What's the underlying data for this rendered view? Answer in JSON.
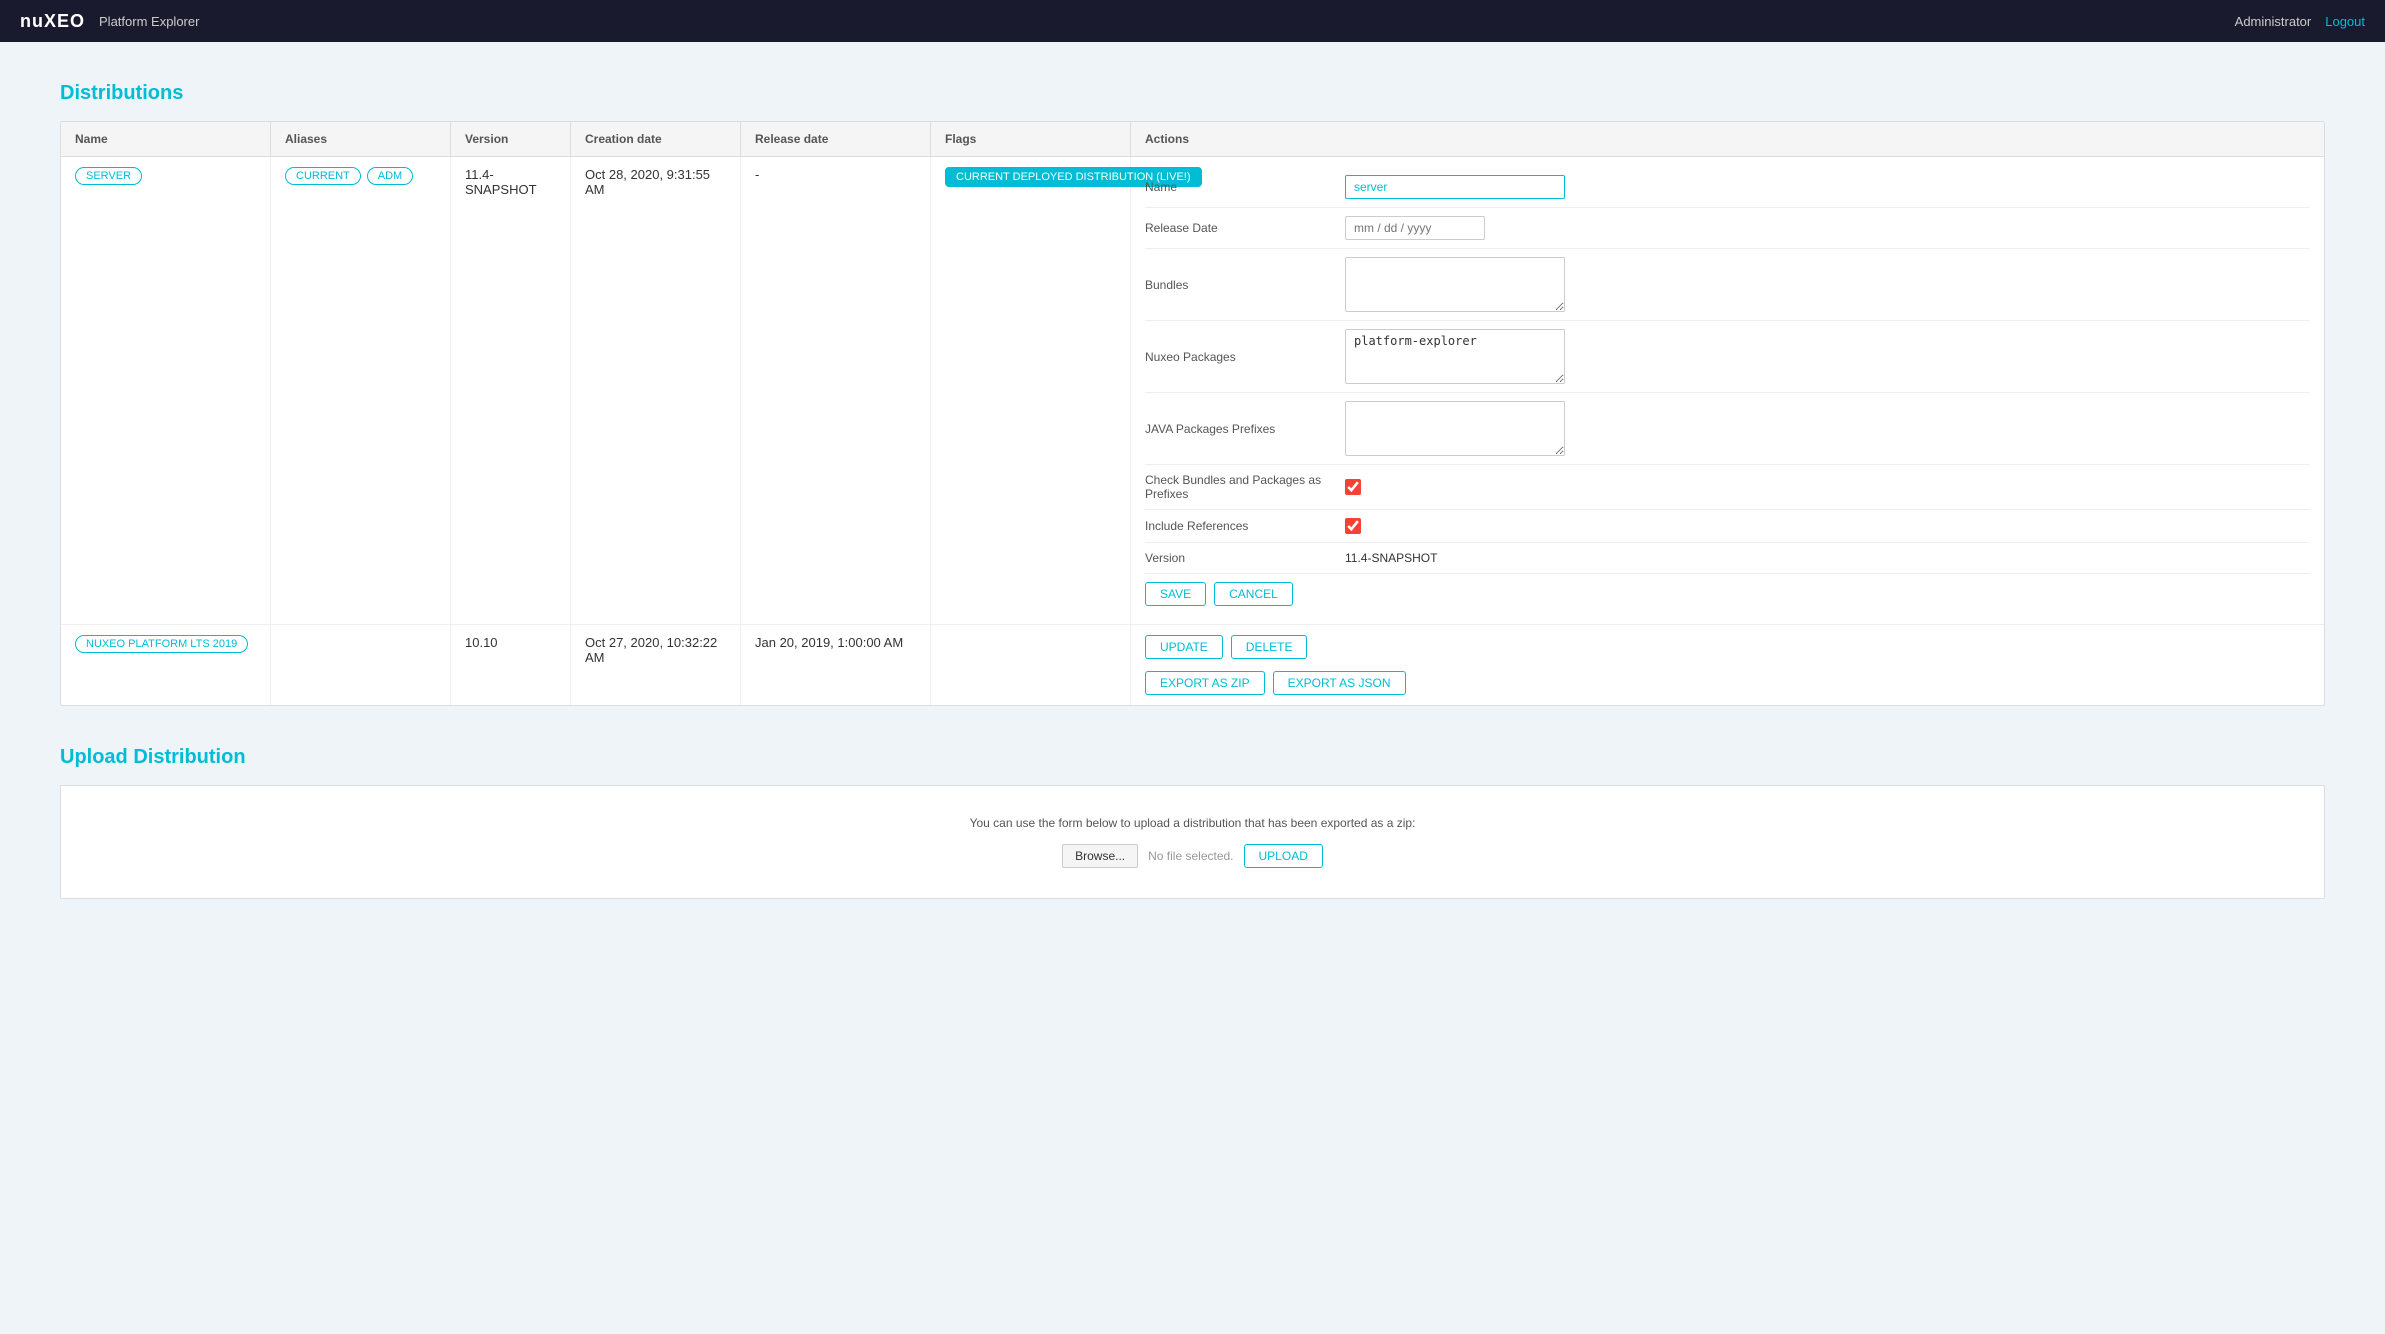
{
  "header": {
    "logo_nu": "nu",
    "logo_xeo": "XEO",
    "platform_explorer": "Platform Explorer",
    "user": "Administrator",
    "logout": "Logout"
  },
  "distributions": {
    "title": "Distributions",
    "table_headers": [
      "Name",
      "Aliases",
      "Version",
      "Creation date",
      "Release date",
      "Flags",
      "Actions"
    ],
    "row1": {
      "name_badge": "SERVER",
      "aliases": [
        "CURRENT",
        "ADM"
      ],
      "version": "11.4-SNAPSHOT",
      "creation_date": "Oct 28, 2020, 9:31:55 AM",
      "release_date": "-",
      "flag_badge": "CURRENT DEPLOYED DISTRIBUTION (LIVE!)"
    },
    "actions_form": {
      "name_label": "Name",
      "name_value": "server",
      "release_date_label": "Release Date",
      "release_date_placeholder": "mm / dd / yyyy",
      "bundles_label": "Bundles",
      "bundles_value": "",
      "nuxeo_packages_label": "Nuxeo Packages",
      "nuxeo_packages_value": "platform-explorer",
      "java_packages_label": "JAVA Packages Prefixes",
      "java_packages_value": "",
      "check_bundles_label": "Check Bundles and Packages as Prefixes",
      "include_refs_label": "Include References",
      "version_label": "Version",
      "version_value": "11.4-SNAPSHOT",
      "save_btn": "SAVE",
      "cancel_btn": "CANCEL"
    },
    "row2": {
      "name_badge": "NUXEO PLATFORM LTS 2019",
      "aliases": [],
      "version": "10.10",
      "creation_date": "Oct 27, 2020, 10:32:22 AM",
      "release_date": "Jan 20, 2019, 1:00:00 AM",
      "flag": ""
    },
    "row2_actions": {
      "update_btn": "UPDATE",
      "delete_btn": "DELETE",
      "export_zip_btn": "EXPORT AS ZIP",
      "export_json_btn": "EXPORT AS JSON"
    }
  },
  "upload": {
    "title": "Upload Distribution",
    "description": "You can use the form below to upload a distribution that has been exported as a zip:",
    "browse_btn": "Browse...",
    "no_file_text": "No file selected.",
    "upload_btn": "UPLOAD"
  }
}
